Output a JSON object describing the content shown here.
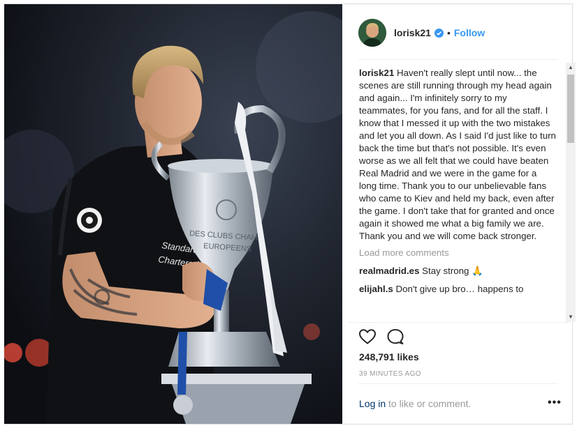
{
  "post": {
    "username": "lorisk21",
    "separator": "•",
    "follow_label": "Follow",
    "caption_user": "lorisk21",
    "caption_text": " Haven't really slept until now... the scenes are still running through my head again and again... I'm infinitely sorry to my teammates, for you fans, and for all the staff. I know that I messed it up with the two mistakes and let you all down. As I said I'd just like to turn back the time but that's not possible. It's even worse as we all felt that we could have beaten Real Madrid and we were in the game for a long time. Thank you to our unbelievable fans who came to Kiev and held my back, even after the game. I don't take that for granted and once again it showed me what a big family we are. Thank you and we will come back stronger.",
    "load_more": "Load more comments",
    "comments": [
      {
        "user": "realmadrid.es",
        "text": " Stay strong 🙏"
      },
      {
        "user": "elijahl.s",
        "text": " Don't give up bro… happens to"
      }
    ],
    "likes": "248,791 likes",
    "time": "39 MINUTES AGO",
    "login_link": "Log in",
    "login_rest": " to like or comment.",
    "more_label": "•••"
  },
  "colors": {
    "link_blue": "#3897f0",
    "text_dark": "#262626",
    "text_muted": "#999999"
  },
  "icons": {
    "verified": "verified-badge-icon",
    "like": "heart-icon",
    "comment": "speech-bubble-icon",
    "more": "more-options-icon"
  }
}
